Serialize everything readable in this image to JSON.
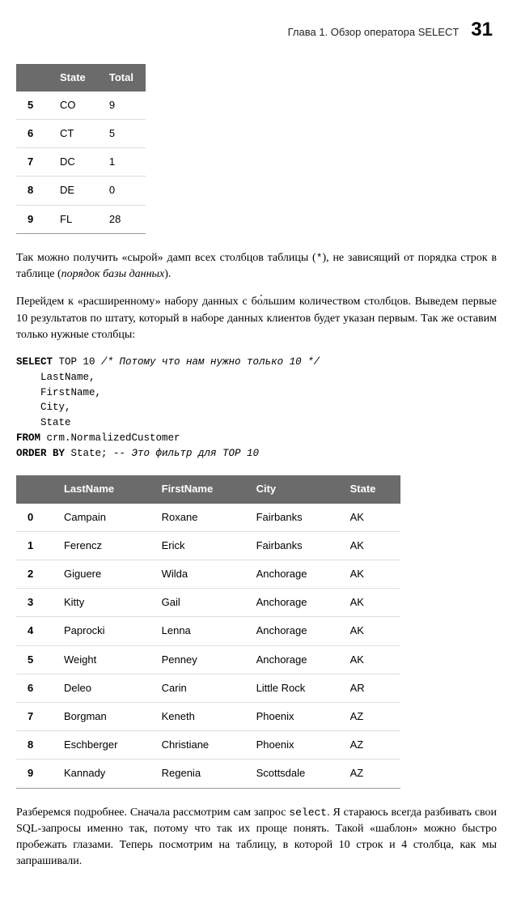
{
  "header": {
    "chapter": "Глава 1. Обзор оператора SELECT",
    "page": "31"
  },
  "table1": {
    "headers": [
      "",
      "State",
      "Total"
    ],
    "rows": [
      [
        "5",
        "CO",
        "9"
      ],
      [
        "6",
        "CT",
        "5"
      ],
      [
        "7",
        "DC",
        "1"
      ],
      [
        "8",
        "DE",
        "0"
      ],
      [
        "9",
        "FL",
        "28"
      ]
    ]
  },
  "para1_a": "Так можно получить «сырой» дамп всех столбцов таблицы (",
  "para1_b": "), не зависящий от порядка строк в таблице (",
  "para1_c": "порядок базы данных",
  "para1_d": ").",
  "para1_star": "*",
  "para2": "Перейдем к «расширенному» набору данных с бо́льшим количеством столбцов. Выведем первые 10 результатов по штату, который в наборе данных клиентов будет указан первым. Так же оставим только нужные столбцы:",
  "code": {
    "l1_kw1": "SELECT",
    "l1_text": " TOP 10 ",
    "l1_comment": "/* Потому что нам нужно только 10 */",
    "l2": "    LastName,",
    "l3": "    FirstName,",
    "l4": "    City,",
    "l5": "    State",
    "l6_kw": "FROM",
    "l6_text": " crm.NormalizedCustomer",
    "l7_kw": "ORDER BY",
    "l7_text": " State; ",
    "l7_comment": "-- Это фильтр для TOP 10"
  },
  "table2": {
    "headers": [
      "",
      "LastName",
      "FirstName",
      "City",
      "State"
    ],
    "rows": [
      [
        "0",
        "Campain",
        "Roxane",
        "Fairbanks",
        "AK"
      ],
      [
        "1",
        "Ferencz",
        "Erick",
        "Fairbanks",
        "AK"
      ],
      [
        "2",
        "Giguere",
        "Wilda",
        "Anchorage",
        "AK"
      ],
      [
        "3",
        "Kitty",
        "Gail",
        "Anchorage",
        "AK"
      ],
      [
        "4",
        "Paprocki",
        "Lenna",
        "Anchorage",
        "AK"
      ],
      [
        "5",
        "Weight",
        "Penney",
        "Anchorage",
        "AK"
      ],
      [
        "6",
        "Deleo",
        "Carin",
        "Little Rock",
        "AR"
      ],
      [
        "7",
        "Borgman",
        "Keneth",
        "Phoenix",
        "AZ"
      ],
      [
        "8",
        "Eschberger",
        "Christiane",
        "Phoenix",
        "AZ"
      ],
      [
        "9",
        "Kannady",
        "Regenia",
        "Scottsdale",
        "AZ"
      ]
    ]
  },
  "para3_a": "Разберемся подробнее. Сначала рассмотрим сам запрос ",
  "para3_select": "select",
  "para3_b": ". Я стараюсь всегда разбивать свои SQL-запросы именно так, потому что так их проще понять. Такой «шаблон» можно быстро пробежать глазами. Теперь посмотрим на таблицу, в которой 10 строк и 4 столбца, как мы запрашивали."
}
